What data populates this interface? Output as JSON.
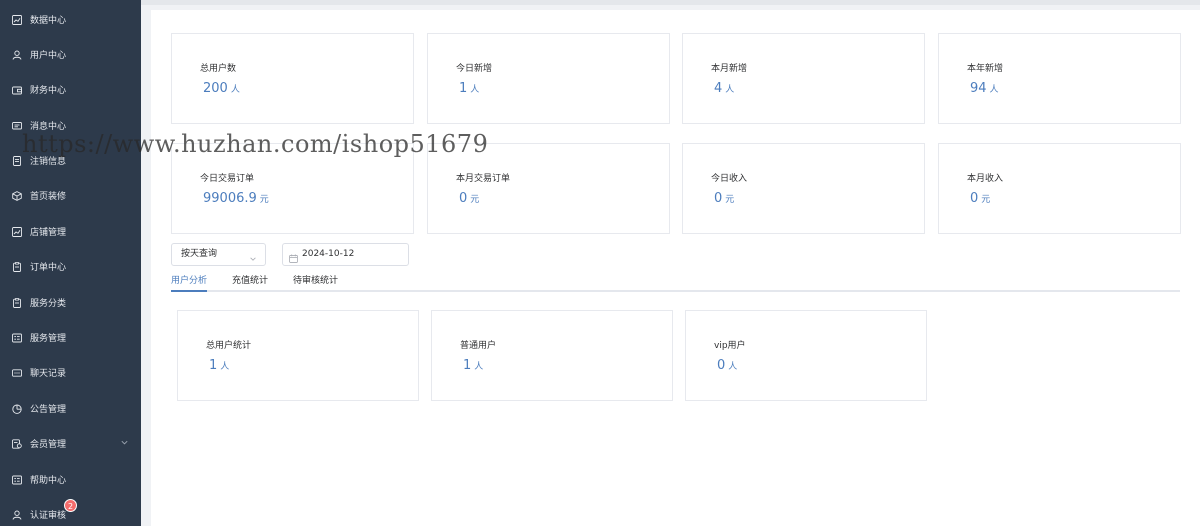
{
  "sidebar": {
    "items": [
      {
        "label": "数据中心",
        "icon": "chart-line-icon"
      },
      {
        "label": "用户中心",
        "icon": "user-icon"
      },
      {
        "label": "财务中心",
        "icon": "wallet-icon"
      },
      {
        "label": "消息中心",
        "icon": "message-icon"
      },
      {
        "label": "注销信息",
        "icon": "document-icon"
      },
      {
        "label": "首页装修",
        "icon": "cube-icon"
      },
      {
        "label": "店铺管理",
        "icon": "chart-line-icon"
      },
      {
        "label": "订单中心",
        "icon": "clipboard-icon"
      },
      {
        "label": "服务分类",
        "icon": "clipboard-icon"
      },
      {
        "label": "服务管理",
        "icon": "list-icon"
      },
      {
        "label": "聊天记录",
        "icon": "chat-icon"
      },
      {
        "label": "公告管理",
        "icon": "pie-chart-icon"
      },
      {
        "label": "会员管理",
        "icon": "member-icon"
      },
      {
        "label": "帮助中心",
        "icon": "list-icon"
      },
      {
        "label": "认证审核",
        "icon": "user-icon",
        "badge": "2"
      }
    ]
  },
  "stats": [
    {
      "label": "总用户数",
      "value": "200",
      "unit": "人"
    },
    {
      "label": "今日新增",
      "value": "1",
      "unit": "人"
    },
    {
      "label": "本月新增",
      "value": "4",
      "unit": "人"
    },
    {
      "label": "本年新增",
      "value": "94",
      "unit": "人"
    },
    {
      "label": "今日交易订单",
      "value": "99006.9",
      "unit": "元"
    },
    {
      "label": "本月交易订单",
      "value": "0",
      "unit": "元"
    },
    {
      "label": "今日收入",
      "value": "0",
      "unit": "元"
    },
    {
      "label": "本月收入",
      "value": "0",
      "unit": "元"
    }
  ],
  "filter": {
    "query_type": "按天查询",
    "date": "2024-10-12"
  },
  "tabs": [
    {
      "label": "用户分析",
      "active": true
    },
    {
      "label": "充值统计",
      "active": false
    },
    {
      "label": "待审核统计",
      "active": false
    }
  ],
  "analysis": [
    {
      "label": "总用户统计",
      "value": "1",
      "unit": "人"
    },
    {
      "label": "普通用户",
      "value": "1",
      "unit": "人"
    },
    {
      "label": "vip用户",
      "value": "0",
      "unit": "人"
    }
  ],
  "watermark": "https://www.huzhan.com/ishop51679",
  "colors": {
    "sidebar_bg": "#2d3a4b",
    "accent": "#4c7dbd",
    "badge": "#f56c6c"
  }
}
